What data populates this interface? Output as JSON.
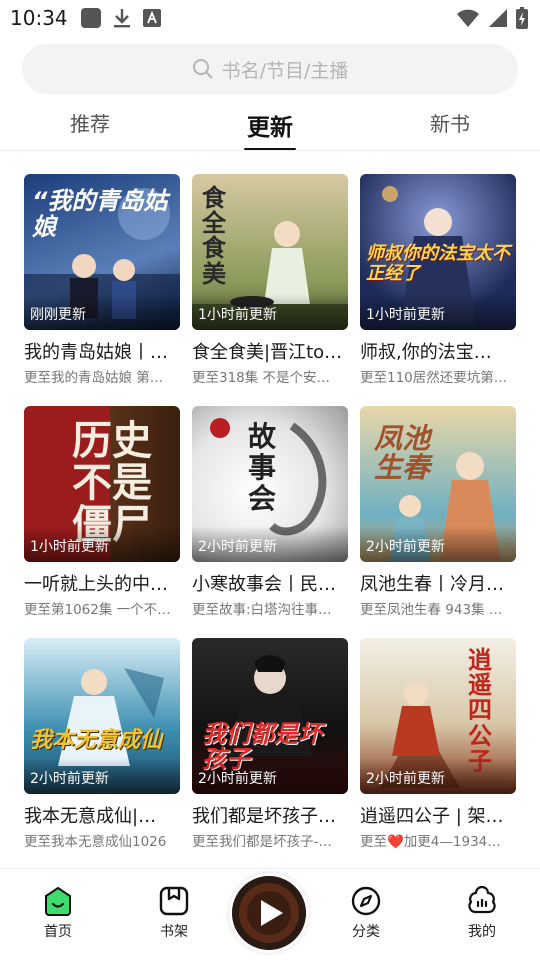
{
  "status": {
    "time": "10:34"
  },
  "search": {
    "placeholder": "书名/节目/主播"
  },
  "tabs": [
    {
      "label": "推荐",
      "active": false
    },
    {
      "label": "更新",
      "active": true
    },
    {
      "label": "新书",
      "active": false
    }
  ],
  "cards": [
    {
      "time": "刚刚更新",
      "title": "我的青岛姑娘丨…",
      "subtitle": "更至我的青岛姑娘 第…",
      "cover_text": "“我的青岛姑娘",
      "colors": [
        "#1b3d7a",
        "#5a7fb8"
      ]
    },
    {
      "time": "1小时前更新",
      "title": "食全食美|晋江to…",
      "subtitle": "更至318集 不是个安…",
      "cover_text": "食全食美",
      "colors": [
        "#6f7a4a",
        "#d7c9a2"
      ]
    },
    {
      "time": "1小时前更新",
      "title": "师叔,你的法宝…",
      "subtitle": "更至110居然还要坑第…",
      "cover_text": "师叔你的法宝太不正经了",
      "colors": [
        "#1e2a58",
        "#6c7db7"
      ]
    },
    {
      "time": "1小时前更新",
      "title": "一听就上头的中…",
      "subtitle": "更至第1062集 一个不…",
      "cover_text": "历史不是僵尸",
      "colors": [
        "#9b1c1c",
        "#5a3018"
      ]
    },
    {
      "time": "2小时前更新",
      "title": "小寒故事会丨民…",
      "subtitle": "更至故事:白塔沟往事…",
      "cover_text": "故事会",
      "colors": [
        "#f2f2f2",
        "#7a7a7a"
      ]
    },
    {
      "time": "2小时前更新",
      "title": "凤池生春丨冷月…",
      "subtitle": "更至凤池生春 943集 …",
      "cover_text": "凤池生春",
      "colors": [
        "#e9d7a8",
        "#6fb0c2"
      ]
    },
    {
      "time": "2小时前更新",
      "title": "我本无意成仙|…",
      "subtitle": "更至我本无意成仙1026",
      "cover_text": "我本无意成仙",
      "colors": [
        "#3a8db0",
        "#d8eef7"
      ]
    },
    {
      "time": "2小时前更新",
      "title": "我们都是坏孩子…",
      "subtitle": "更至我们都是坏孩子-…",
      "cover_text": "我们都是坏孩子",
      "colors": [
        "#111111",
        "#8a1a1a"
      ]
    },
    {
      "time": "2小时前更新",
      "title": "逍遥四公子 | 架…",
      "subtitle": "更至❤️加更4—1934…",
      "cover_text": "逍遥四公子",
      "colors": [
        "#f3efe6",
        "#8a3a20"
      ]
    }
  ],
  "nav": [
    {
      "label": "首页",
      "icon": "home-icon",
      "active": true
    },
    {
      "label": "书架",
      "icon": "bookshelf-icon",
      "active": false
    },
    {
      "label": "分类",
      "icon": "compass-icon",
      "active": false
    },
    {
      "label": "我的",
      "icon": "profile-icon",
      "active": false
    }
  ],
  "accent": "#3ddc6c"
}
